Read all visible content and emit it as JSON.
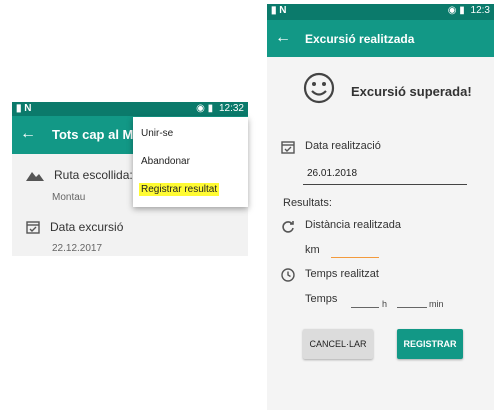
{
  "left_screen": {
    "status": {
      "left_icons": "▮ N",
      "right_icons": "◉ ▮",
      "time": "12:32"
    },
    "appbar": {
      "back_icon": "←",
      "title": "Tots cap al Mon"
    },
    "route": {
      "label": "Ruta escollida:",
      "value": "Montau"
    },
    "excursion_date": {
      "label": "Data excursió",
      "value": "22.12.2017"
    },
    "menu": {
      "items": [
        "Unir-se",
        "Abandonar",
        "Registrar resultat"
      ],
      "highlight_color": "#fffb33"
    }
  },
  "right_screen": {
    "status": {
      "left_icons": "▮ N",
      "right_icons": "◉ ▮",
      "time": "12:3"
    },
    "appbar": {
      "back_icon": "←",
      "title": "Excursió realitzada"
    },
    "headline": "Excursió superada!",
    "date": {
      "label": "Data realització",
      "value": "26.01.2018"
    },
    "results_label": "Resultats:",
    "distance": {
      "label": "Distància realitzada",
      "unit": "km",
      "value": ""
    },
    "time": {
      "label": "Temps realitzat",
      "prefix": "Temps",
      "hours_unit": "h",
      "minutes_unit": "min"
    },
    "buttons": {
      "cancel": "CANCEL·LAR",
      "register": "REGISTRAR"
    }
  },
  "colors": {
    "primary": "#129886",
    "primary_dark": "#0b7a6b",
    "accent": "#f39a3c"
  }
}
